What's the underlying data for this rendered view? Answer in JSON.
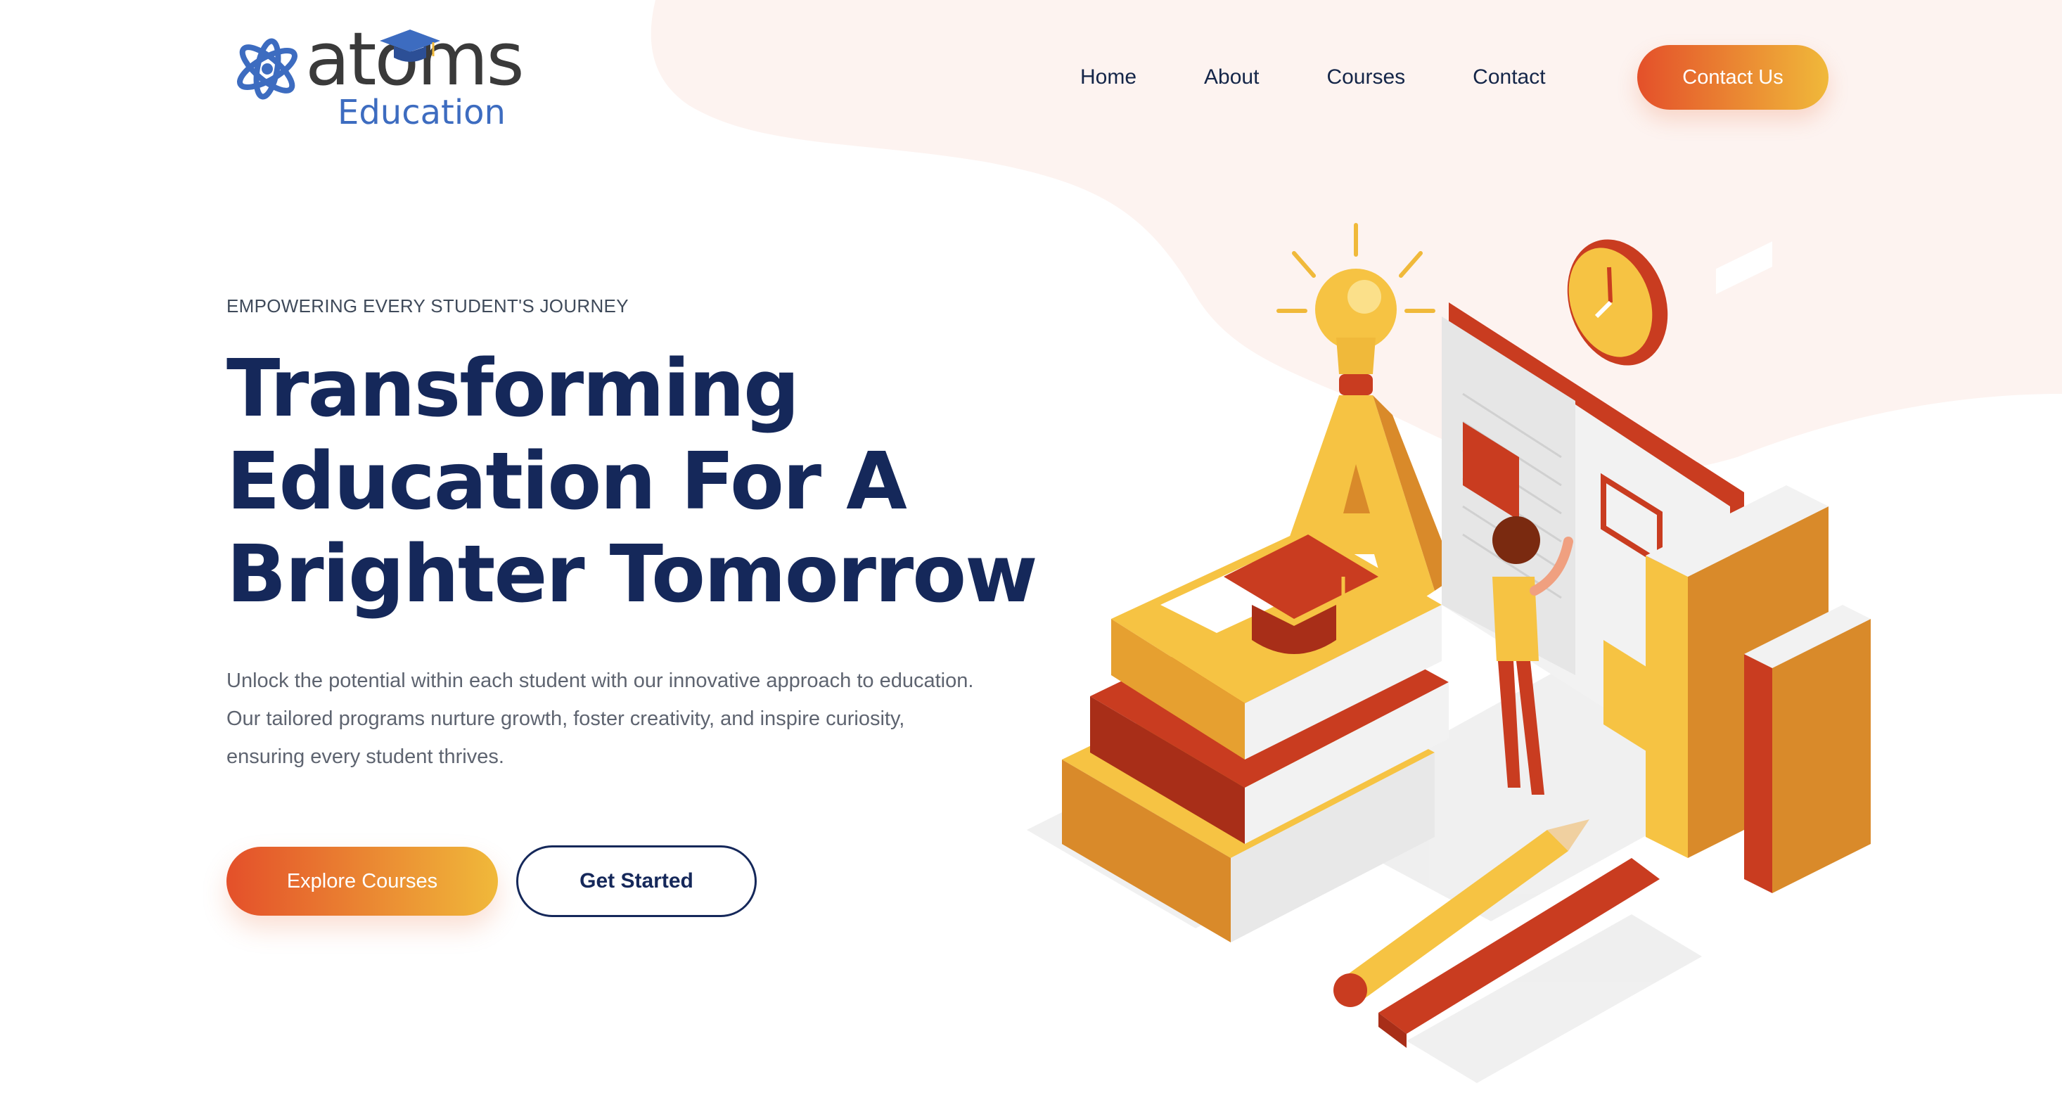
{
  "brand": {
    "logo_word": "atoms",
    "logo_sub": "Education",
    "colors": {
      "blue": "#3d6cc0",
      "dark": "#3a3a3a"
    }
  },
  "nav": {
    "items": [
      {
        "label": "Home"
      },
      {
        "label": "About"
      },
      {
        "label": "Courses"
      },
      {
        "label": "Contact"
      }
    ],
    "cta_label": "Contact Us"
  },
  "hero": {
    "eyebrow": "EMPOWERING EVERY STUDENT'S JOURNEY",
    "title_lines": [
      "Transforming",
      "Education For A",
      "Brighter Tomorrow"
    ],
    "description_lines": [
      "Unlock the potential within each student with our innovative approach to education.",
      "Our tailored programs nurture growth, foster creativity, and inspire curiosity,",
      "ensuring every student thrives."
    ],
    "primary_button": "Explore Courses",
    "secondary_button": "Get Started"
  },
  "theme": {
    "navy": "#15285a",
    "gradient_start": "#e4502a",
    "gradient_end": "#f0b93a",
    "blob": "#fdf3f0"
  },
  "illustration": {
    "name": "isometric-education-illustration",
    "icons": [
      "lightbulb-icon",
      "letter-a-icon",
      "clock-icon",
      "books-stack-icon",
      "graduation-cap-icon",
      "student-figure-icon",
      "pencil-icon",
      "ruler-icon",
      "binders-icon"
    ]
  }
}
